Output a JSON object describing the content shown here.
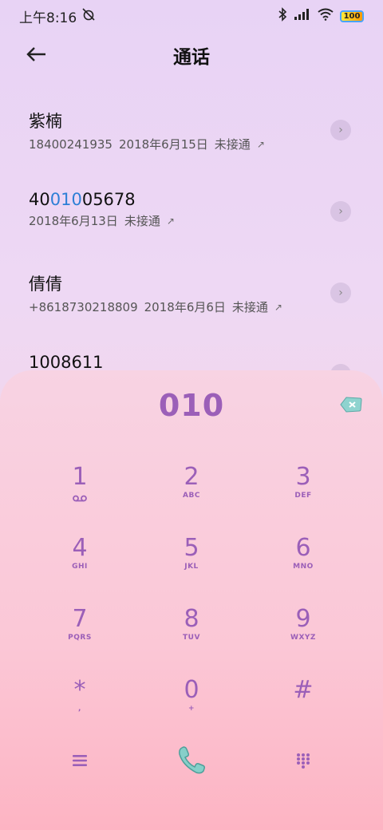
{
  "status": {
    "time": "上午8:16",
    "battery": "100"
  },
  "header": {
    "title": "通话"
  },
  "calls": [
    {
      "name": "紫楠",
      "number": "18400241935",
      "date": "2018年6月15日",
      "status": "未接通"
    },
    {
      "name_pre": "40",
      "name_hl": "010",
      "name_post": "05678",
      "number": "",
      "date": "2018年6月13日",
      "status": "未接通"
    },
    {
      "name": "倩倩",
      "number": "+8618730218809",
      "date": "2018年6月6日",
      "status": "未接通"
    },
    {
      "name": "1008611"
    }
  ],
  "dialpad": {
    "input": "010",
    "keys": [
      {
        "digit": "1",
        "letters": ""
      },
      {
        "digit": "2",
        "letters": "ABC"
      },
      {
        "digit": "3",
        "letters": "DEF"
      },
      {
        "digit": "4",
        "letters": "GHI"
      },
      {
        "digit": "5",
        "letters": "JKL"
      },
      {
        "digit": "6",
        "letters": "MNO"
      },
      {
        "digit": "7",
        "letters": "PQRS"
      },
      {
        "digit": "8",
        "letters": "TUV"
      },
      {
        "digit": "9",
        "letters": "WXYZ"
      },
      {
        "digit": "*",
        "letters": ","
      },
      {
        "digit": "0",
        "letters": "+"
      },
      {
        "digit": "#",
        "letters": ""
      }
    ]
  },
  "colors": {
    "accent": "#9b5fb8",
    "call_button": "#7cc7c7",
    "highlight": "#2d7fd6"
  },
  "icons": {
    "back": "back-arrow-icon",
    "detail": "chevron-right-icon",
    "backspace": "backspace-icon",
    "menu": "menu-icon",
    "call": "phone-icon",
    "keypad": "keypad-icon"
  }
}
